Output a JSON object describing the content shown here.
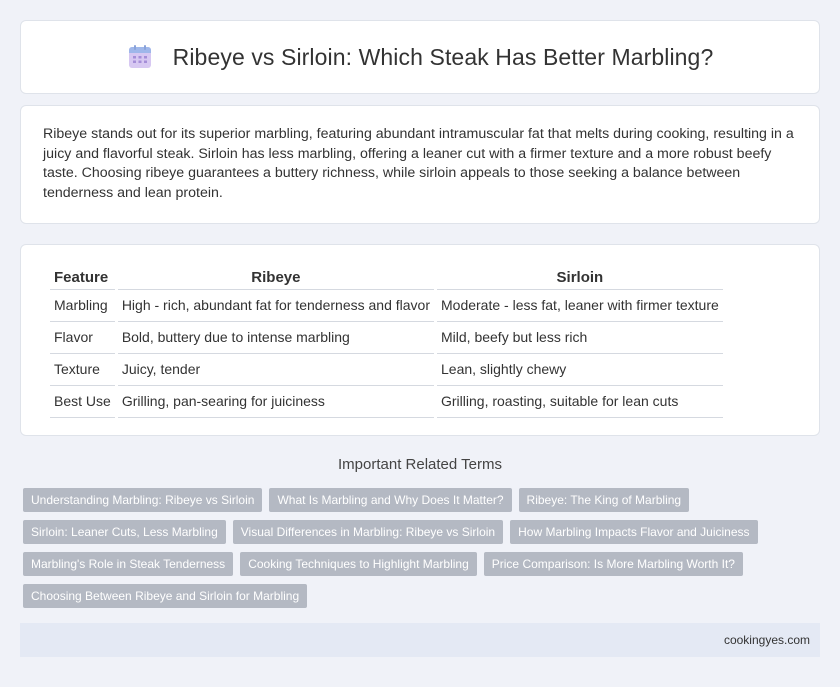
{
  "header": {
    "title": "Ribeye vs Sirloin: Which Steak Has Better Marbling?",
    "icon": "calendar-icon"
  },
  "intro": {
    "text": "Ribeye stands out for its superior marbling, featuring abundant intramuscular fat that melts during cooking, resulting in a juicy and flavorful steak. Sirloin has less marbling, offering a leaner cut with a firmer texture and a more robust beefy taste. Choosing ribeye guarantees a buttery richness, while sirloin appeals to those seeking a balance between tenderness and lean protein."
  },
  "table": {
    "headers": [
      "Feature",
      "Ribeye",
      "Sirloin"
    ],
    "rows": [
      [
        "Marbling",
        "High - rich, abundant fat for tenderness and flavor",
        "Moderate - less fat, leaner with firmer texture"
      ],
      [
        "Flavor",
        "Bold, buttery due to intense marbling",
        "Mild, beefy but less rich"
      ],
      [
        "Texture",
        "Juicy, tender",
        "Lean, slightly chewy"
      ],
      [
        "Best Use",
        "Grilling, pan-searing for juiciness",
        "Grilling, roasting, suitable for lean cuts"
      ]
    ]
  },
  "related": {
    "title": "Important Related Terms",
    "tags": [
      "Understanding Marbling: Ribeye vs Sirloin",
      "What Is Marbling and Why Does It Matter?",
      "Ribeye: The King of Marbling",
      "Sirloin: Leaner Cuts, Less Marbling",
      "Visual Differences in Marbling: Ribeye vs Sirloin",
      "How Marbling Impacts Flavor and Juiciness",
      "Marbling's Role in Steak Tenderness",
      "Cooking Techniques to Highlight Marbling",
      "Price Comparison: Is More Marbling Worth It?",
      "Choosing Between Ribeye and Sirloin for Marbling"
    ]
  },
  "footer": {
    "site": "cookingyes.com"
  },
  "colors": {
    "background": "#f0f2f8",
    "tag": "#b4b9c3",
    "footer": "#e4e9f4",
    "icon_top": "#9fb7ea",
    "icon_body": "#c9b6ee"
  }
}
